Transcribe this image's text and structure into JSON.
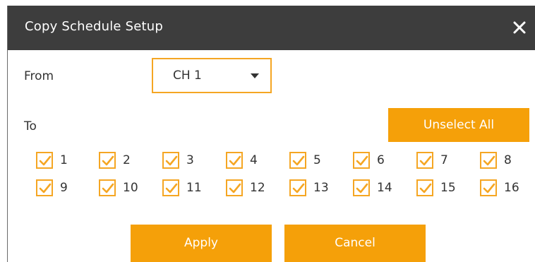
{
  "dialog": {
    "title": "Copy Schedule Setup",
    "close_icon": "close-icon"
  },
  "from": {
    "label": "From",
    "selected": "CH 1"
  },
  "to": {
    "label": "To",
    "unselect_all_label": "Unselect All"
  },
  "channels": [
    {
      "label": "1",
      "checked": true
    },
    {
      "label": "2",
      "checked": true
    },
    {
      "label": "3",
      "checked": true
    },
    {
      "label": "4",
      "checked": true
    },
    {
      "label": "5",
      "checked": true
    },
    {
      "label": "6",
      "checked": true
    },
    {
      "label": "7",
      "checked": true
    },
    {
      "label": "8",
      "checked": true
    },
    {
      "label": "9",
      "checked": true
    },
    {
      "label": "10",
      "checked": true
    },
    {
      "label": "11",
      "checked": true
    },
    {
      "label": "12",
      "checked": true
    },
    {
      "label": "13",
      "checked": true
    },
    {
      "label": "14",
      "checked": true
    },
    {
      "label": "15",
      "checked": true
    },
    {
      "label": "16",
      "checked": true
    }
  ],
  "actions": {
    "apply_label": "Apply",
    "cancel_label": "Cancel"
  },
  "colors": {
    "accent": "#f5a009",
    "titlebar": "#3d3d3d",
    "checkbox_border": "#f5a623"
  }
}
